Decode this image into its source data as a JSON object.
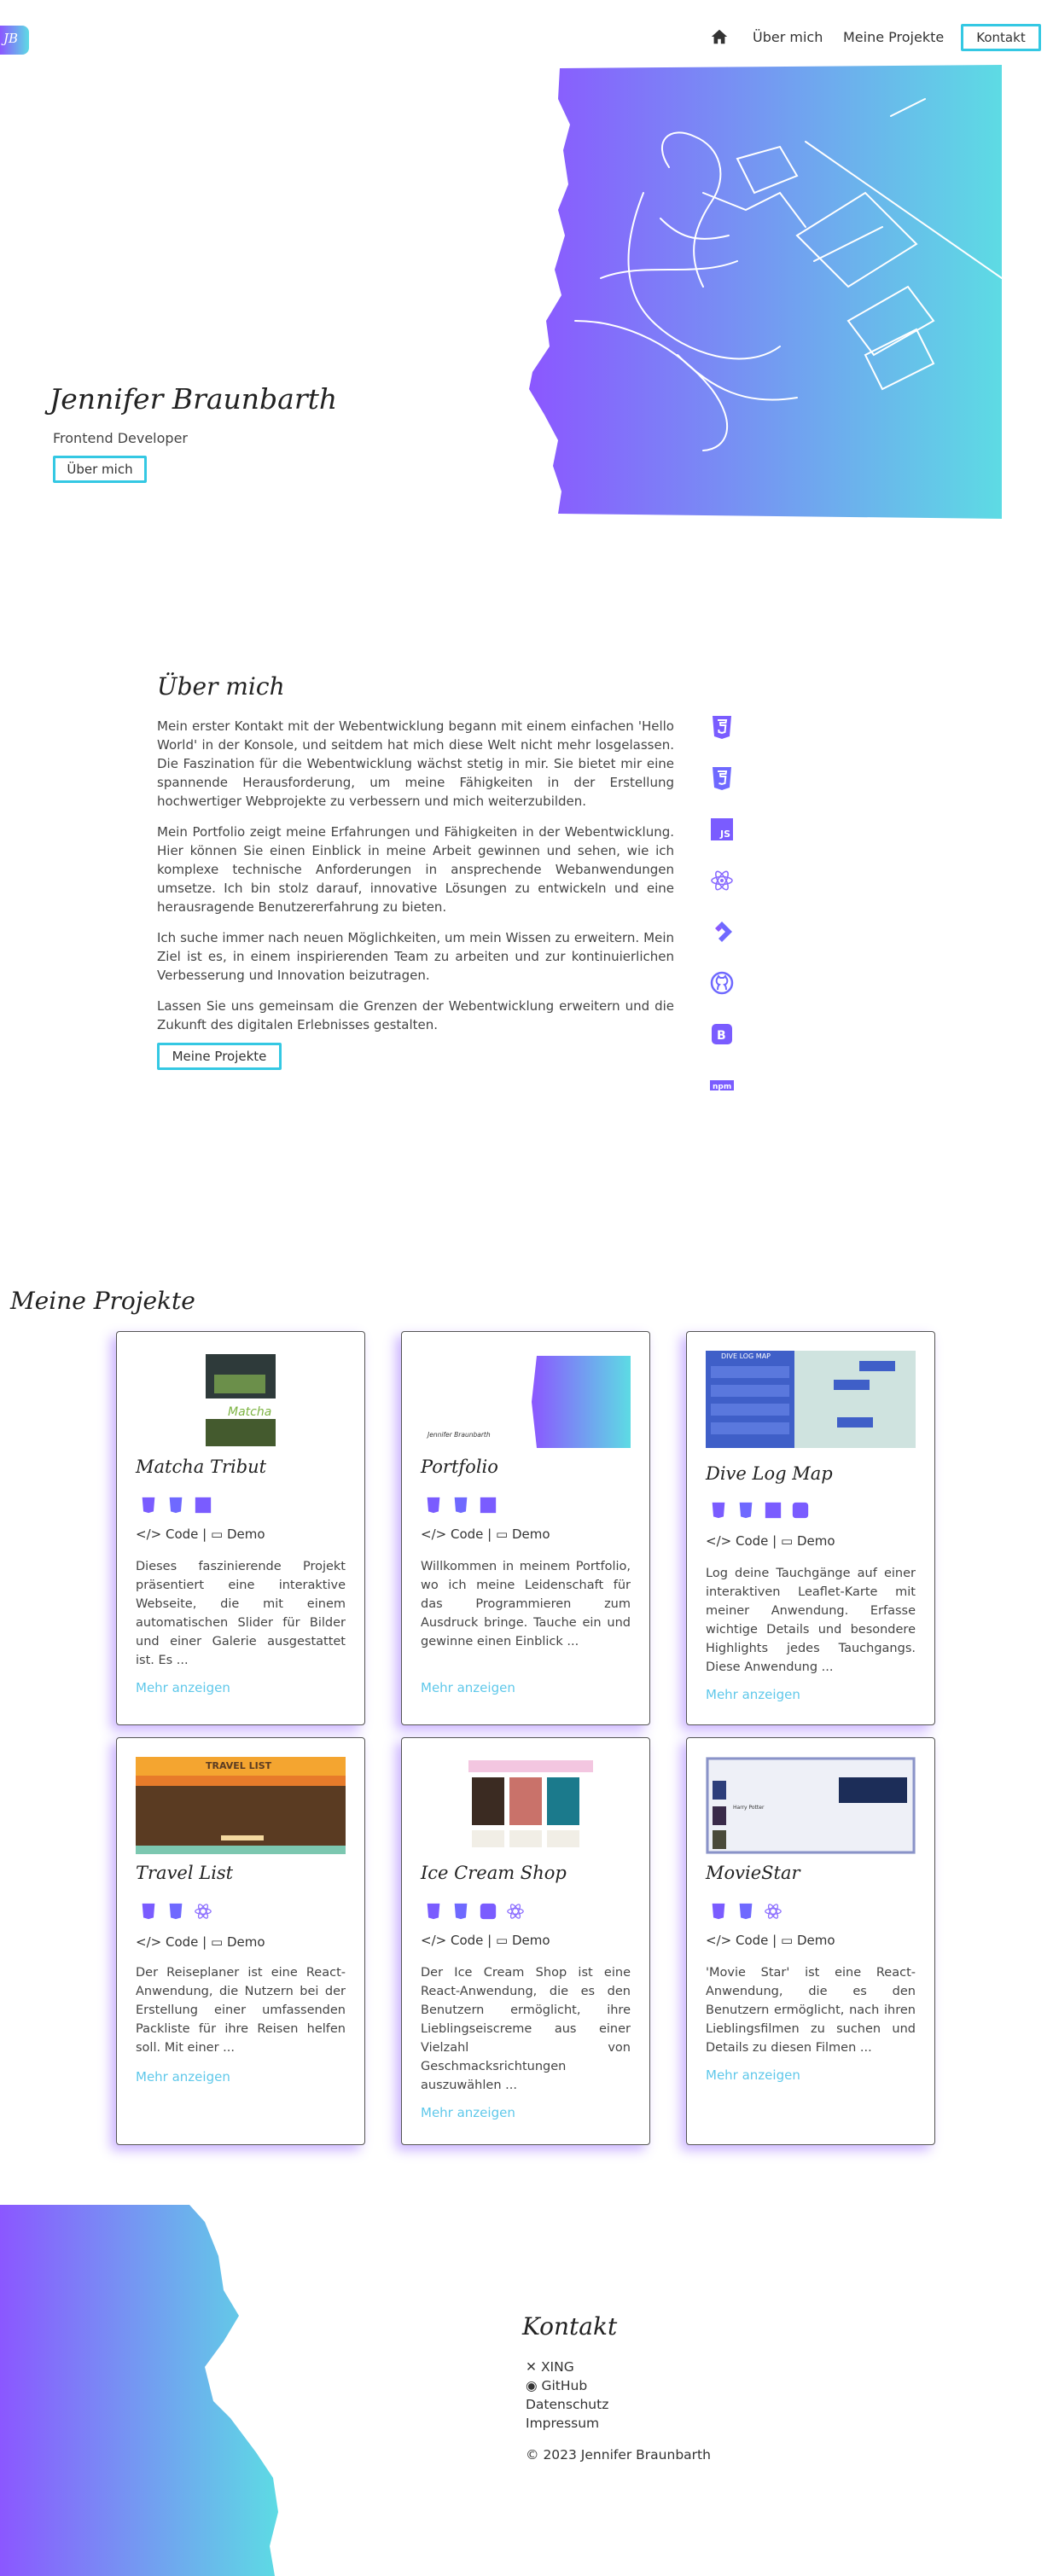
{
  "header": {
    "logo_text": "JB",
    "nav": {
      "about": "Über mich",
      "projects": "Meine Projekte",
      "contact": "Kontakt"
    }
  },
  "hero": {
    "name": "Jennifer Braunbarth",
    "subtitle": "Frontend Developer",
    "button": "Über mich"
  },
  "about": {
    "title": "Über mich",
    "paragraphs": [
      "Mein erster Kontakt mit der Webentwicklung begann mit einem einfachen 'Hello World' in der Konsole, und seitdem hat mich diese Welt nicht mehr losgelassen. Die Faszination für die Webentwicklung wächst stetig in mir. Sie bietet mir eine spannende Herausforderung, um meine Fähigkeiten in der Erstellung hochwertiger Webprojekte zu verbessern und mich weiterzubilden.",
      "Mein Portfolio zeigt meine Erfahrungen und Fähigkeiten in der Webentwicklung. Hier können Sie einen Einblick in meine Arbeit gewinnen und sehen, wie ich komplexe technische Anforderungen in ansprechende Webanwendungen umsetze. Ich bin stolz darauf, innovative Lösungen zu entwickeln und eine herausragende Benutzererfahrung zu bieten.",
      "Ich suche immer nach neuen Möglichkeiten, um mein Wissen zu erweitern. Mein Ziel ist es, in einem inspirierenden Team zu arbeiten und zur kontinuierlichen Verbesserung und Innovation beizutragen.",
      "Lassen Sie uns gemeinsam die Grenzen der Webentwicklung erweitern und die Zukunft des digitalen Erlebnisses gestalten."
    ],
    "button": "Meine Projekte",
    "skills": [
      "html5-icon",
      "css3-icon",
      "javascript-icon",
      "react-icon",
      "jira-icon",
      "github-icon",
      "bootstrap-icon",
      "npm-icon"
    ]
  },
  "projects": {
    "title": "Meine Projekte",
    "code_label": "Code",
    "separator": "|",
    "demo_label": "Demo",
    "more_label": "Mehr anzeigen",
    "items": [
      {
        "title": "Matcha Tribut",
        "desc": "Dieses faszinierende Projekt präsentiert eine interaktive Webseite, die mit einem automatischen Slider für Bilder und einer Galerie ausgestattet ist. Es ...",
        "shot_text": "Matcha"
      },
      {
        "title": "Portfolio",
        "desc": "Willkommen in meinem Portfolio, wo ich meine Leidenschaft für das Programmieren zum Ausdruck bringe. Tauche ein und gewinne einen Einblick ...",
        "shot_text": "Jennifer Braunbarth"
      },
      {
        "title": "Dive Log Map",
        "desc": "Log deine Tauchgänge auf einer interaktiven Leaflet-Karte mit meiner Anwendung. Erfasse wichtige Details und besondere Highlights jedes Tauchgangs. Diese Anwendung ...",
        "shot_text": "DIVE LOG MAP"
      },
      {
        "title": "Travel List",
        "desc": "Der Reiseplaner ist eine React-Anwendung, die Nutzern bei der Erstellung einer umfassenden Packliste für ihre Reisen helfen soll. Mit einer ...",
        "shot_text": "TRAVEL LIST"
      },
      {
        "title": "Ice Cream Shop",
        "desc": "Der Ice Cream Shop ist eine React-Anwendung, die es den Benutzern ermöglicht, ihre Lieblingseiscreme aus einer Vielzahl von Geschmacksrichtungen auszuwählen ...",
        "shot_text": ""
      },
      {
        "title": "MovieStar",
        "desc": "'Movie Star' ist eine React-Anwendung, die es den Benutzern ermöglicht, nach ihren Lieblingsfilmen zu suchen und Details zu diesen Filmen ...",
        "shot_text": "Harry Potter"
      }
    ]
  },
  "footer": {
    "title": "Kontakt",
    "links": [
      "XING",
      "GitHub",
      "Datenschutz",
      "Impressum"
    ],
    "copyright": "2023 Jennifer Braunbarth"
  },
  "colors": {
    "gradient_start": "#8b57ff",
    "gradient_end": "#5ddbe4",
    "accent": "#34c8e3",
    "link": "#5fc8ea"
  }
}
